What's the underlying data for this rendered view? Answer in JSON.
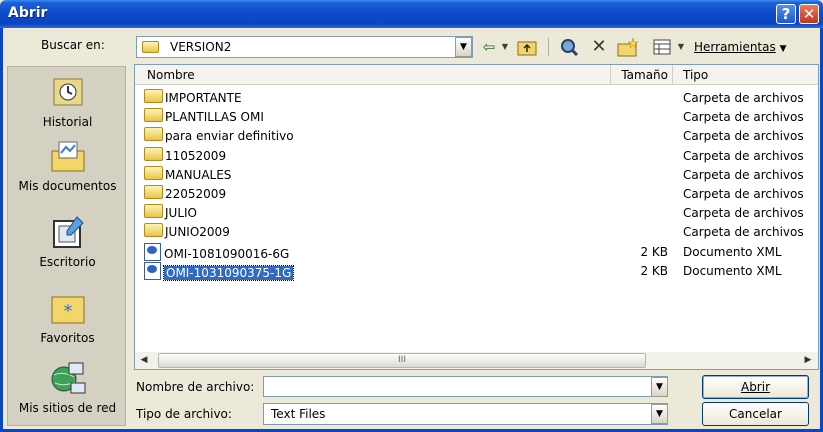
{
  "window": {
    "title": "Abrir",
    "help_glyph": "?",
    "close_glyph": "✕"
  },
  "lookin": {
    "label": "Buscar en:",
    "value": "VERSION2"
  },
  "toolbar": {
    "tools_label": "Herramientas",
    "icons": [
      "back-icon",
      "up-folder-icon",
      "search-web-icon",
      "delete-icon",
      "new-folder-icon",
      "views-icon"
    ]
  },
  "places": [
    {
      "label": "Historial",
      "icon": "history-icon"
    },
    {
      "label": "Mis documentos",
      "icon": "my-documents-icon"
    },
    {
      "label": "Escritorio",
      "icon": "desktop-icon"
    },
    {
      "label": "Favoritos",
      "icon": "favorites-icon"
    },
    {
      "label": "Mis sitios de red",
      "icon": "network-places-icon"
    }
  ],
  "columns": {
    "name": "Nombre",
    "size": "Tamaño",
    "type": "Tipo"
  },
  "files": [
    {
      "name": "IMPORTANTE",
      "size": "",
      "type": "Carpeta de archivos",
      "kind": "folder"
    },
    {
      "name": "PLANTILLAS OMI",
      "size": "",
      "type": "Carpeta de archivos",
      "kind": "folder"
    },
    {
      "name": "para enviar definitivo",
      "size": "",
      "type": "Carpeta de archivos",
      "kind": "folder"
    },
    {
      "name": "11052009",
      "size": "",
      "type": "Carpeta de archivos",
      "kind": "folder"
    },
    {
      "name": "MANUALES",
      "size": "",
      "type": "Carpeta de archivos",
      "kind": "folder"
    },
    {
      "name": "22052009",
      "size": "",
      "type": "Carpeta de archivos",
      "kind": "folder"
    },
    {
      "name": "JULIO",
      "size": "",
      "type": "Carpeta de archivos",
      "kind": "folder"
    },
    {
      "name": "JUNIO2009",
      "size": "",
      "type": "Carpeta de archivos",
      "kind": "folder"
    },
    {
      "name": "OMI-1081090016-6G",
      "size": "2 KB",
      "type": "Documento XML",
      "kind": "xml"
    },
    {
      "name": "OMI-1031090375-1G",
      "size": "2 KB",
      "type": "Documento XML",
      "kind": "xml",
      "selected": true
    }
  ],
  "scrollbar": {
    "thumb_glyph": "III",
    "left_glyph": "◀",
    "right_glyph": "▶"
  },
  "filename": {
    "label": "Nombre de archivo:",
    "value": ""
  },
  "filetype": {
    "label": "Tipo de archivo:",
    "value": "Text Files"
  },
  "buttons": {
    "open": "Abrir",
    "cancel": "Cancelar"
  },
  "colors": {
    "titlebar": "#0b45c2",
    "selection": "#316ac5",
    "dialog_bg": "#ece9d8"
  }
}
